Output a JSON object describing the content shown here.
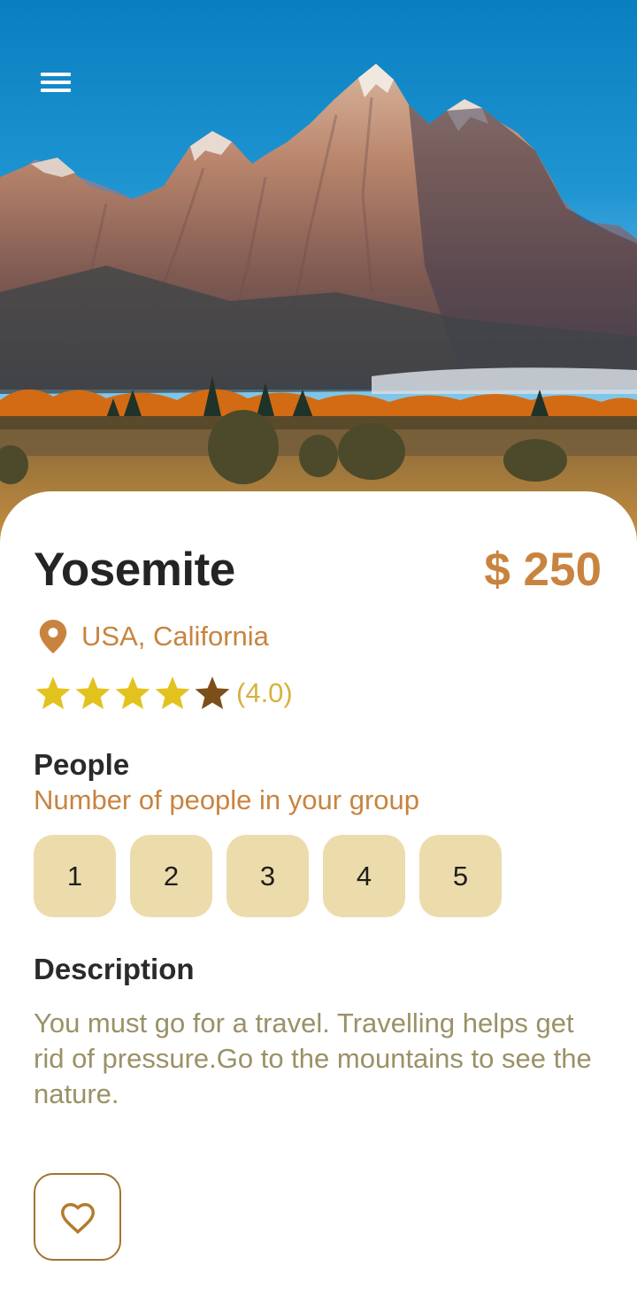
{
  "hero": {
    "menu_icon": "hamburger-menu-icon"
  },
  "place": {
    "name": "Yosemite",
    "price": "$ 250",
    "location": "USA, California",
    "location_icon": "location-pin-icon",
    "rating": 4.0,
    "rating_text": "(4.0)"
  },
  "people": {
    "title": "People",
    "subtitle": "Number of people in your group",
    "options": [
      "1",
      "2",
      "3",
      "4",
      "5"
    ]
  },
  "description": {
    "title": "Description",
    "text": "You must go for a travel. Travelling helps get rid of pressure.Go to the mountains to see the nature."
  },
  "actions": {
    "favorite_icon": "heart-icon"
  },
  "colors": {
    "accent": "#c8843f",
    "star_filled": "#e3c21d",
    "star_empty": "#7c4f1a",
    "chip_bg": "#ecdcab",
    "description_text": "#9a9166"
  }
}
